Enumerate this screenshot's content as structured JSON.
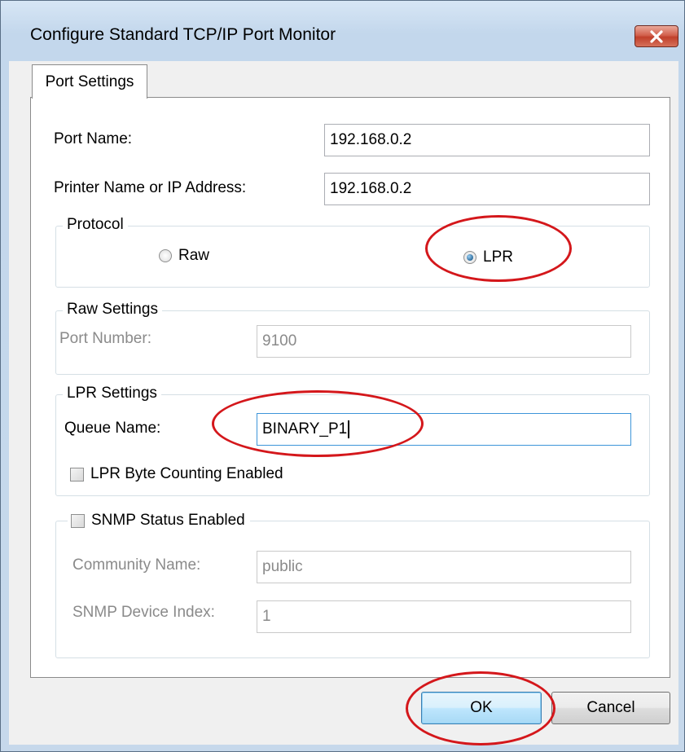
{
  "window": {
    "title": "Configure Standard TCP/IP Port Monitor",
    "close_icon": "close-icon"
  },
  "tabs": [
    {
      "label": "Port Settings",
      "selected": true
    }
  ],
  "port_settings": {
    "port_name_label": "Port Name:",
    "port_name_value": "192.168.0.2",
    "printer_name_label": "Printer Name or IP Address:",
    "printer_name_value": "192.168.0.2"
  },
  "protocol": {
    "legend": "Protocol",
    "options": [
      {
        "label": "Raw",
        "selected": false
      },
      {
        "label": "LPR",
        "selected": true
      }
    ]
  },
  "raw_settings": {
    "legend": "Raw Settings",
    "port_number_label": "Port Number:",
    "port_number_value": "9100",
    "enabled": false
  },
  "lpr_settings": {
    "legend": "LPR Settings",
    "queue_name_label": "Queue Name:",
    "queue_name_value": "BINARY_P1",
    "byte_counting_label": "LPR Byte Counting Enabled",
    "byte_counting_checked": false
  },
  "snmp": {
    "status_label": "SNMP Status Enabled",
    "status_checked": false,
    "community_name_label": "Community Name:",
    "community_name_value": "public",
    "device_index_label": "SNMP Device Index:",
    "device_index_value": "1",
    "enabled": false
  },
  "buttons": {
    "ok_label": "OK",
    "cancel_label": "Cancel"
  },
  "annotations": {
    "highlight_color": "#d4171b"
  }
}
